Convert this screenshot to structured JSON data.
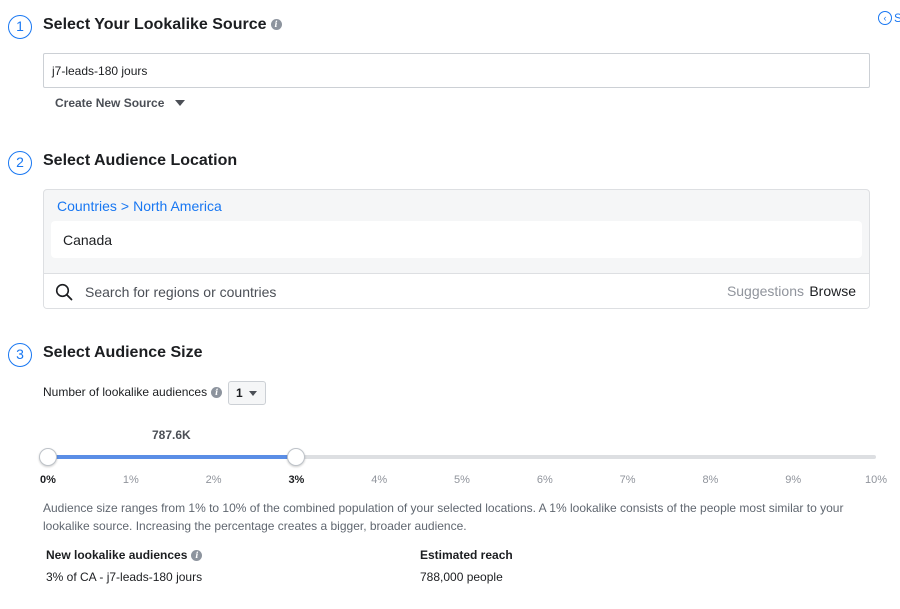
{
  "top_right_link": "S",
  "step1": {
    "number": "1",
    "title": "Select Your Lookalike Source",
    "source_value": "j7-leads-180 jours",
    "create_new_label": "Create New Source"
  },
  "step2": {
    "number": "2",
    "title": "Select Audience Location",
    "breadcrumb": [
      "Countries",
      "North America"
    ],
    "selected_country": "Canada",
    "search_placeholder": "Search for regions or countries",
    "suggestions_label": "Suggestions",
    "browse_label": "Browse"
  },
  "step3": {
    "number": "3",
    "title": "Select Audience Size",
    "num_audiences_label": "Number of lookalike audiences",
    "num_audiences_value": "1",
    "slider": {
      "reach_label": "787.6K",
      "range_start_percent": 0,
      "range_end_percent": 3,
      "ticks": [
        "0%",
        "1%",
        "2%",
        "3%",
        "4%",
        "5%",
        "6%",
        "7%",
        "8%",
        "9%",
        "10%"
      ]
    },
    "description": "Audience size ranges from 1% to 10% of the combined population of your selected locations. A 1% lookalike consists of the people most similar to your lookalike source. Increasing the percentage creates a bigger, broader audience.",
    "table": {
      "col1_header": "New lookalike audiences",
      "col2_header": "Estimated reach",
      "row": {
        "audience": "3% of CA - j7-leads-180 jours",
        "reach": "788,000 people"
      }
    }
  },
  "colors": {
    "accent": "#1877f2",
    "slider_fill": "#5b8ee6"
  }
}
